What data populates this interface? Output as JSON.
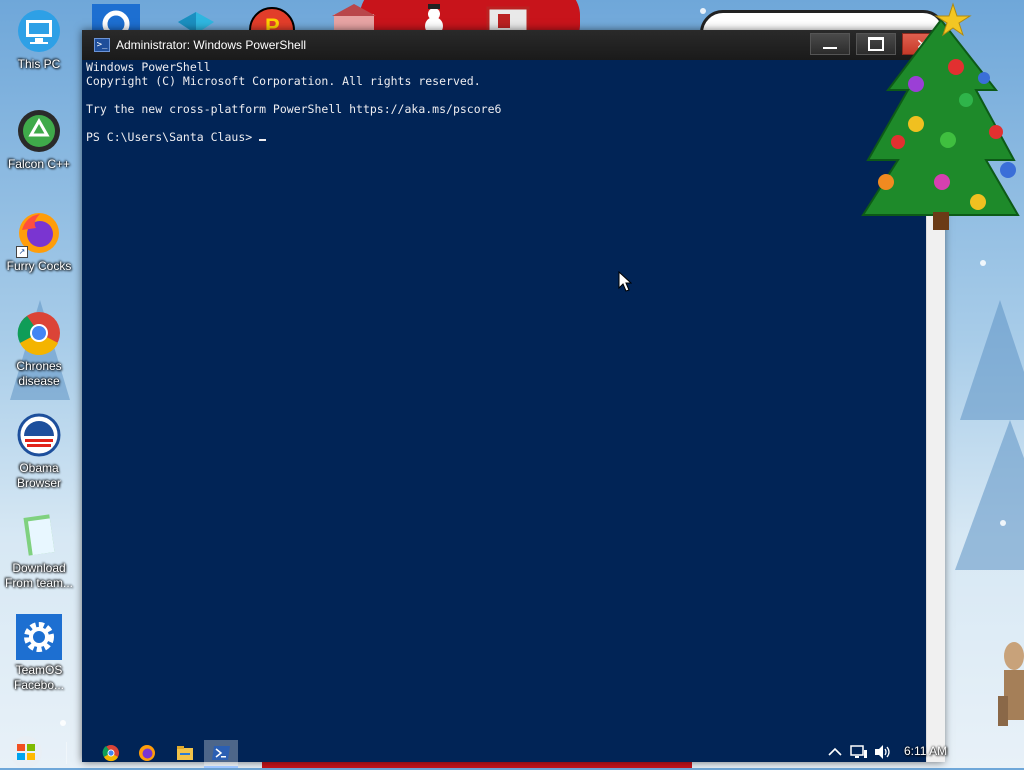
{
  "desktop": {
    "icons": [
      {
        "label": "This PC",
        "icon": "computer-icon"
      },
      {
        "label": "Falcon C++",
        "icon": "recycle-icon"
      },
      {
        "label": "Furry Cocks",
        "icon": "firefox-icon"
      },
      {
        "label": "Chrones disease",
        "icon": "chrome-icon"
      },
      {
        "label": "Obama Browser",
        "icon": "obama-logo-icon"
      },
      {
        "label": "Download From team...",
        "icon": "notepad-icon"
      },
      {
        "label": "TeamOS Facebo...",
        "icon": "gear-icon"
      }
    ]
  },
  "window": {
    "title": "Administrator: Windows PowerShell",
    "console_lines": [
      "Windows PowerShell",
      "Copyright (C) Microsoft Corporation. All rights reserved.",
      "",
      "Try the new cross-platform PowerShell https://aka.ms/pscore6",
      ""
    ],
    "prompt": "PS C:\\Users\\Santa Claus> ",
    "close_glyph": "✕"
  },
  "taskbar": {
    "pinned": [
      "chrome-icon",
      "firefox-icon",
      "file-explorer-icon",
      "powershell-icon"
    ],
    "clock": "6:11 AM"
  },
  "colors": {
    "console_bg": "#012456",
    "console_fg": "#eeedf0",
    "titlebar": "#1a1a1a"
  }
}
